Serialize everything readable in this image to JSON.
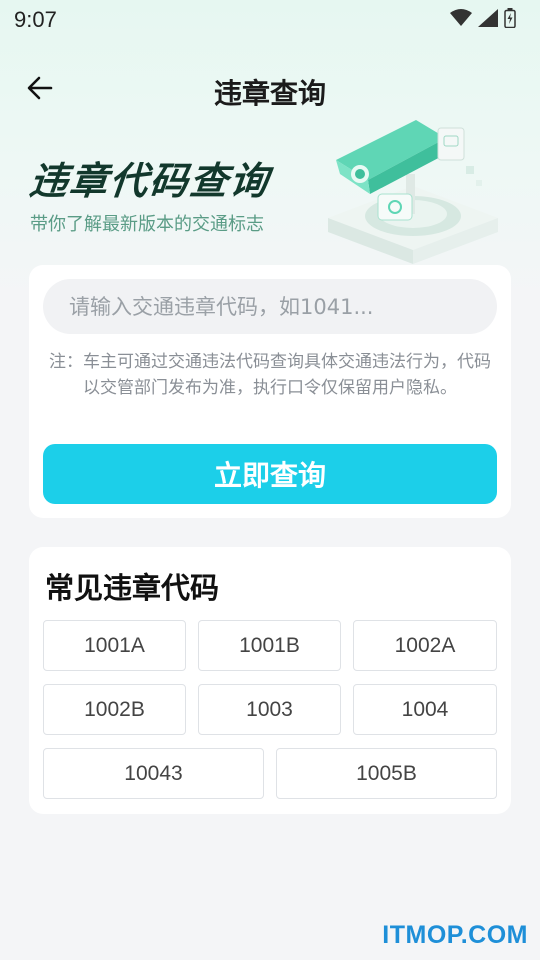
{
  "status_bar": {
    "time": "9:07"
  },
  "nav": {
    "title": "违章查询"
  },
  "hero": {
    "title": "违章代码查询",
    "subtitle": "带你了解最新版本的交通标志"
  },
  "search": {
    "placeholder": "请输入交通违章代码，如1041...",
    "value": "",
    "note": "注：车主可通过交通违法代码查询具体交通违法行为，代码以交管部门发布为准，执行口令仅保留用户隐私。",
    "button_label": "立即查询"
  },
  "common_codes": {
    "title": "常见违章代码",
    "items": [
      "1001A",
      "1001B",
      "1002A",
      "1002B",
      "1003",
      "1004",
      "10043",
      "1005B"
    ]
  },
  "watermark": "ITMOP.COM",
  "colors": {
    "accent": "#1ccfe9",
    "hero_title": "#12382c",
    "hero_sub": "#5a9c86",
    "watermark": "#1e8fd8"
  }
}
